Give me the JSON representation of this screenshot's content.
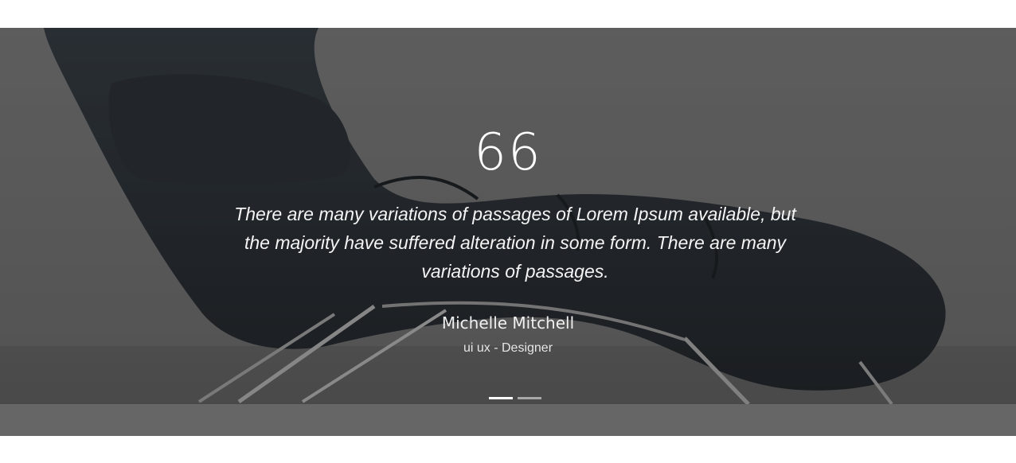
{
  "testimonial": {
    "quote_icon": "66",
    "text": "There are many variations of passages of Lorem Ipsum available, but the majority have suffered alteration in some form. There are many variations of passages.",
    "author_name": "Michelle Mitchell",
    "author_role": "ui ux - Designer"
  },
  "carousel": {
    "slide_count": 2,
    "active_index": 0
  },
  "colors": {
    "text": "#ffffff",
    "overlay": "#282828",
    "dot_active": "#ffffff",
    "dot_inactive": "#a8a8a8",
    "strip": "#666666"
  },
  "background_image": "dark-lounge-chair-photo"
}
